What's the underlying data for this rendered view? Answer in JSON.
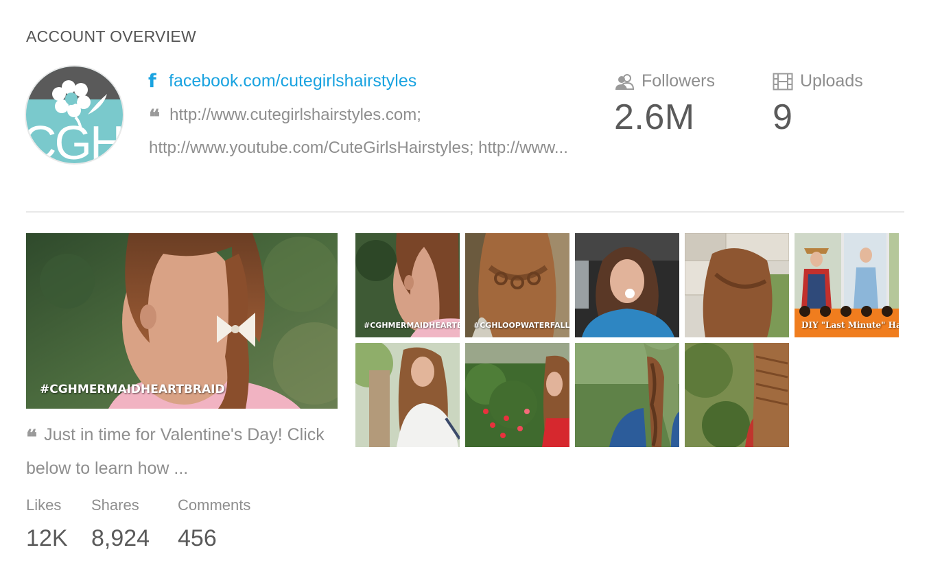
{
  "section": {
    "title": "ACCOUNT OVERVIEW"
  },
  "account": {
    "avatar_text": "CGH",
    "platform_icon": "facebook-icon",
    "link": "facebook.com/cutegirlshairstyles",
    "quote_mark": "❝",
    "description": "http://www.cutegirlshairstyles.com; http://www.youtube.com/CuteGirlsHairstyles; http://www..."
  },
  "stats": [
    {
      "icon": "followers-icon",
      "label": "Followers",
      "value": "2.6M"
    },
    {
      "icon": "film-icon",
      "label": "Uploads",
      "value": "9"
    }
  ],
  "featured_post": {
    "overlay": "#CGHMERMAIDHEARTBRAID",
    "caption": "Just in time for Valentine's Day! Click below to learn how ...",
    "metrics": [
      {
        "label": "Likes",
        "value": "12K"
      },
      {
        "label": "Shares",
        "value": "8,924"
      },
      {
        "label": "Comments",
        "value": "456"
      }
    ]
  },
  "thumbnails": [
    {
      "overlay": "#CGHMERMAIDHEARTBR"
    },
    {
      "overlay": "#CGHLOOPWATERFALL"
    },
    {
      "overlay": ""
    },
    {
      "overlay": ""
    },
    {
      "overlay": "DIY \"Last Minute\" Hal"
    },
    {
      "overlay": ""
    },
    {
      "overlay": ""
    },
    {
      "overlay": ""
    },
    {
      "overlay": ""
    }
  ],
  "colors": {
    "link": "#1aa3e0",
    "avatar_bg": "#7ac9cc",
    "text": "#8e8e8e",
    "value": "#5a5a5a"
  }
}
